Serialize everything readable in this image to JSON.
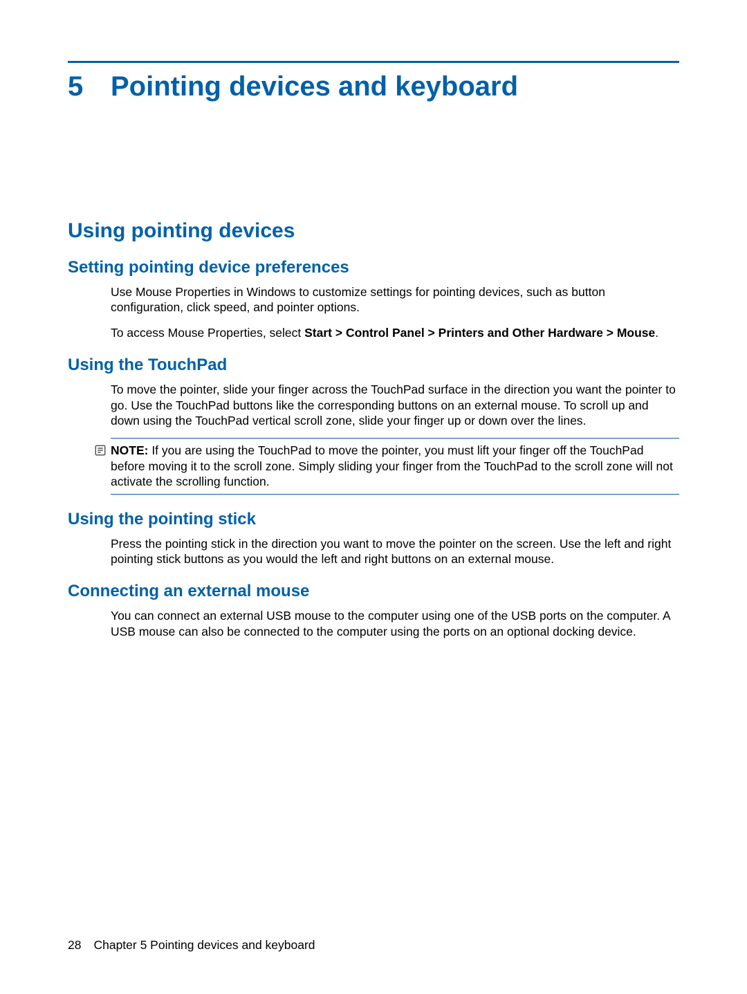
{
  "chapter": {
    "number": "5",
    "title": "Pointing devices and keyboard"
  },
  "h1": "Using pointing devices",
  "sections": {
    "prefs": {
      "heading": "Setting pointing device preferences",
      "p1": "Use Mouse Properties in Windows to customize settings for pointing devices, such as button configuration, click speed, and pointer options.",
      "p2_a": "To access Mouse Properties, select ",
      "p2_bold": "Start > Control Panel > Printers and Other Hardware > Mouse",
      "p2_b": "."
    },
    "touchpad": {
      "heading": "Using the TouchPad",
      "p1": "To move the pointer, slide your finger across the TouchPad surface in the direction you want the pointer to go. Use the TouchPad buttons like the corresponding buttons on an external mouse. To scroll up and down using the TouchPad vertical scroll zone, slide your finger up or down over the lines.",
      "note_label": "NOTE:",
      "note_text": " If you are using the TouchPad to move the pointer, you must lift your finger off the TouchPad before moving it to the scroll zone. Simply sliding your finger from the TouchPad to the scroll zone will not activate the scrolling function."
    },
    "stick": {
      "heading": "Using the pointing stick",
      "p1": "Press the pointing stick in the direction you want to move the pointer on the screen. Use the left and right pointing stick buttons as you would the left and right buttons on an external mouse."
    },
    "mouse": {
      "heading": "Connecting an external mouse",
      "p1": "You can connect an external USB mouse to the computer using one of the USB ports on the computer. A USB mouse can also be connected to the computer using the ports on an optional docking device."
    }
  },
  "footer": {
    "page": "28",
    "text": "Chapter 5   Pointing devices and keyboard"
  }
}
